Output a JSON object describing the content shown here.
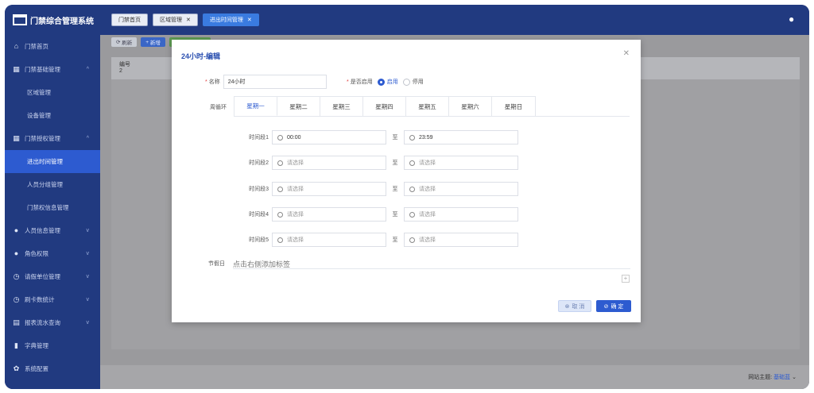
{
  "app": {
    "title": "门禁综合管理系统"
  },
  "sidebar": {
    "items": [
      {
        "label": "门禁首页",
        "icon": "home-icon"
      },
      {
        "label": "门禁基础管理",
        "icon": "grid-icon"
      },
      {
        "label": "区域管理",
        "sub": true
      },
      {
        "label": "设备管理",
        "sub": true
      },
      {
        "label": "门禁授权管理",
        "icon": "grid-icon"
      },
      {
        "label": "进出时间管理",
        "sub": true,
        "active": true
      },
      {
        "label": "人员分组管理",
        "sub": true
      },
      {
        "label": "门禁权信息管理",
        "sub": true
      },
      {
        "label": "人员信息管理",
        "icon": "person-icon"
      },
      {
        "label": "角色权限",
        "icon": "person-icon"
      },
      {
        "label": "请假单位管理",
        "icon": "clock-icon"
      },
      {
        "label": "刷卡数统计",
        "icon": "clock-icon"
      },
      {
        "label": "报表流水查询",
        "icon": "chart-icon"
      },
      {
        "label": "字典管理",
        "icon": "book-icon"
      },
      {
        "label": "系统配置",
        "icon": "gear-icon"
      }
    ]
  },
  "topbar": {
    "tabs": [
      {
        "label": "门禁首页",
        "closable": false
      },
      {
        "label": "区域管理",
        "closable": true
      },
      {
        "label": "进出时间管理",
        "closable": true,
        "active": true
      }
    ]
  },
  "toolbar": {
    "refresh": "刷新",
    "add": "新增"
  },
  "table": {
    "header": "编号",
    "row1": "2"
  },
  "footer": {
    "theme_label": "网站主题:",
    "theme_value": "基础蓝"
  },
  "modal": {
    "title": "24小时-编辑",
    "name_label": "名称",
    "name_value": "24小时",
    "enable_label": "是否启用",
    "enable_on": "启用",
    "enable_off": "停用",
    "cycle_label": "周循环",
    "weekdays": [
      "星期一",
      "星期二",
      "星期三",
      "星期四",
      "星期五",
      "星期六",
      "星期日"
    ],
    "active_day": 0,
    "to_text": "至",
    "periods": [
      {
        "label": "时间段1",
        "start": "00:00",
        "end": "23:59"
      },
      {
        "label": "时间段2",
        "start": "请选择",
        "end": "请选择"
      },
      {
        "label": "时间段3",
        "start": "请选择",
        "end": "请选择"
      },
      {
        "label": "时间段4",
        "start": "请选择",
        "end": "请选择"
      },
      {
        "label": "时间段5",
        "start": "请选择",
        "end": "请选择"
      }
    ],
    "holiday_label": "节假日",
    "holiday_hint": "点击右侧添加标签",
    "cancel": "取 消",
    "ok": "确 定"
  },
  "colors": {
    "accent": "#2d5bd0",
    "sidebar": "#213a80"
  }
}
